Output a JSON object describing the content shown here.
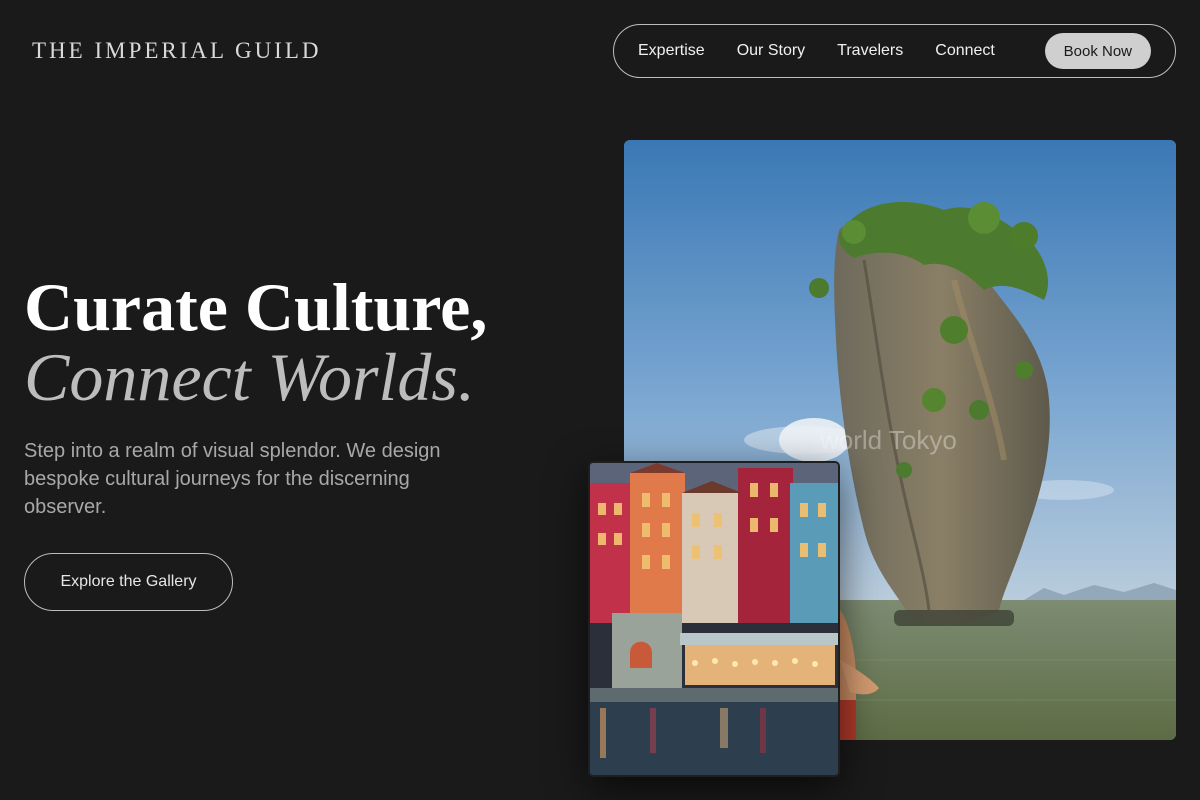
{
  "header": {
    "brand": "THE IMPERIAL GUILD",
    "nav": [
      {
        "label": "Expertise"
      },
      {
        "label": "Our Story"
      },
      {
        "label": "Travelers"
      },
      {
        "label": "Connect"
      }
    ],
    "book_button": "Book Now"
  },
  "hero": {
    "headline_line1": "Curate Culture,",
    "headline_line2": "Connect Worlds.",
    "subcopy": "Step into a realm of visual splendor. We design bespoke cultural journeys for the discerning observer.",
    "cta": "Explore the Gallery"
  },
  "images": {
    "main_watermark": "world Tokyo"
  },
  "colors": {
    "background": "#1a1a1a",
    "button_fill": "#cfcfcf",
    "border": "#bdbdbd",
    "muted_text": "#a8a8a8"
  }
}
